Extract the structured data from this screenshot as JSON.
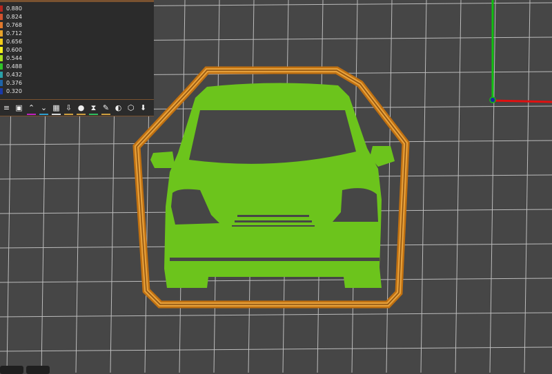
{
  "legend": {
    "items": [
      {
        "value": "0.880",
        "color": "#b5261e"
      },
      {
        "value": "0.824",
        "color": "#d2532e"
      },
      {
        "value": "0.768",
        "color": "#e0782c"
      },
      {
        "value": "0.712",
        "color": "#e6a22a"
      },
      {
        "value": "0.656",
        "color": "#f2cc1a"
      },
      {
        "value": "0.600",
        "color": "#f5f01c"
      },
      {
        "value": "0.544",
        "color": "#a8e01e"
      },
      {
        "value": "0.488",
        "color": "#2ec42a"
      },
      {
        "value": "0.432",
        "color": "#2aa0a8"
      },
      {
        "value": "0.376",
        "color": "#1e64a8"
      },
      {
        "value": "0.320",
        "color": "#1a3aa8"
      }
    ]
  },
  "toolbar": {
    "buttons": [
      {
        "icon": "layers-icon",
        "glyph": "≡",
        "accent": ""
      },
      {
        "icon": "object-icon",
        "glyph": "▣",
        "accent": ""
      },
      {
        "icon": "top-layer-icon",
        "glyph": "⌃",
        "accent": "#c020c0"
      },
      {
        "icon": "bottom-layer-icon",
        "glyph": "⌄",
        "accent": "#30a0d0"
      },
      {
        "icon": "infill-icon",
        "glyph": "▦",
        "accent": "#dddddd"
      },
      {
        "icon": "support-icon",
        "glyph": "⇩",
        "accent": "#d0a040"
      },
      {
        "icon": "color-icon",
        "glyph": "●",
        "accent": "#d0a040"
      },
      {
        "icon": "hourglass-icon",
        "glyph": "⧗",
        "accent": "#30c060"
      },
      {
        "icon": "tool-icon",
        "glyph": "✎",
        "accent": "#d0a040"
      },
      {
        "icon": "center-icon",
        "glyph": "◐",
        "accent": ""
      },
      {
        "icon": "cube-icon",
        "glyph": "⬡",
        "accent": ""
      },
      {
        "icon": "export-icon",
        "glyph": "⬇",
        "accent": ""
      }
    ]
  },
  "colors": {
    "background": "#464646",
    "perimeter": "#d98a22",
    "fill": "#6cc41c",
    "x_axis": "#e01010",
    "y_axis": "#10c010"
  }
}
